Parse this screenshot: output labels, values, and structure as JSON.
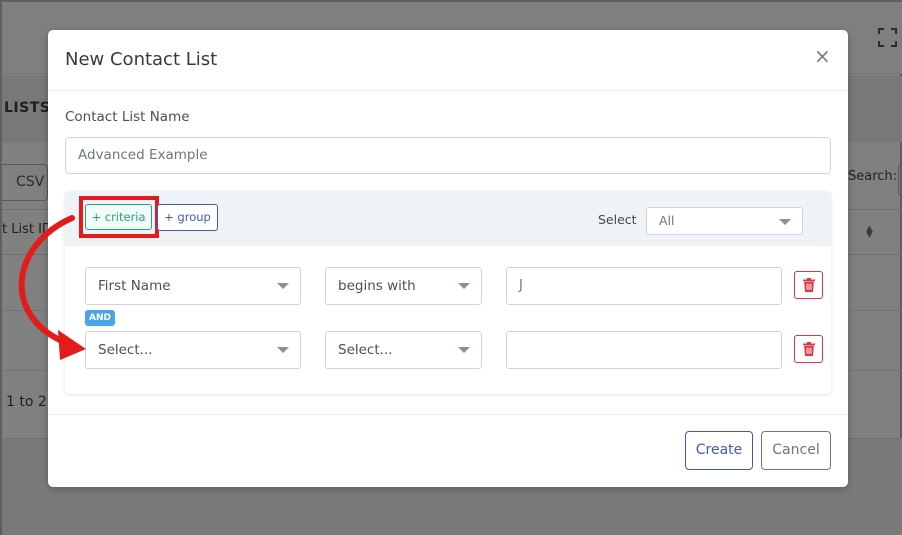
{
  "background": {
    "lists_label": "LISTS",
    "csv_button": "CSV",
    "search_label": "Search:",
    "table_header": "t List ID",
    "info_text": "1 to 2 o"
  },
  "modal": {
    "title": "New Contact List",
    "close_glyph": "×",
    "name_label": "Contact List Name",
    "name_value": "Advanced Example",
    "criteria_button": "+ criteria",
    "group_button": "+ group",
    "select_label": "Select",
    "select_value": "All",
    "rows": [
      {
        "field": "First Name",
        "operator": "begins with",
        "value": "J"
      },
      {
        "field": "Select...",
        "operator": "Select...",
        "value": ""
      }
    ],
    "and_badge": "AND",
    "create_button": "Create",
    "cancel_button": "Cancel"
  },
  "colors": {
    "annotation": "#e31b1b",
    "criteria_green": "#27a17c",
    "primary": "#4458b8",
    "danger": "#dc3545",
    "and_badge": "#4da3e8"
  },
  "icons": {
    "close": "close-icon",
    "trash": "trash-icon",
    "expand": "fullscreen-icon",
    "annotation_arrow": "curved-arrow-icon"
  }
}
